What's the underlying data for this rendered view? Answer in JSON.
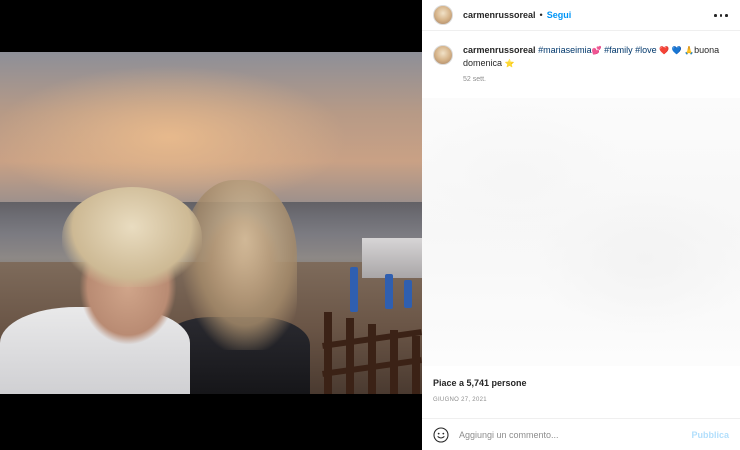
{
  "post": {
    "username": "carmenrussoreal",
    "follow_separator": "•",
    "follow_label": "Segui",
    "caption": {
      "username": "carmenrussoreal",
      "hashtag_1": "#mariaseimia",
      "emoji_1": "💕",
      "hashtag_2": "#family",
      "hashtag_3": "#love",
      "emoji_2": "❤️",
      "emoji_3": "💙",
      "emoji_4": "🙏",
      "text_1": "buona domenica",
      "emoji_5": "⭐"
    },
    "caption_time": "52 sett.",
    "likes_text": "Piace a 5,741 persone",
    "date_text": "GIUGNO 27, 2021"
  },
  "comment_box": {
    "placeholder": "Aggiungi un commento...",
    "publish_label": "Pubblica"
  },
  "icons": {
    "more": "more-options-icon",
    "emoji": "emoji-smiley-icon"
  },
  "colors": {
    "link_blue": "#0095f6",
    "hashtag": "#00376b",
    "publish_disabled": "#b2dffc",
    "muted_text": "#8e8e8e"
  }
}
